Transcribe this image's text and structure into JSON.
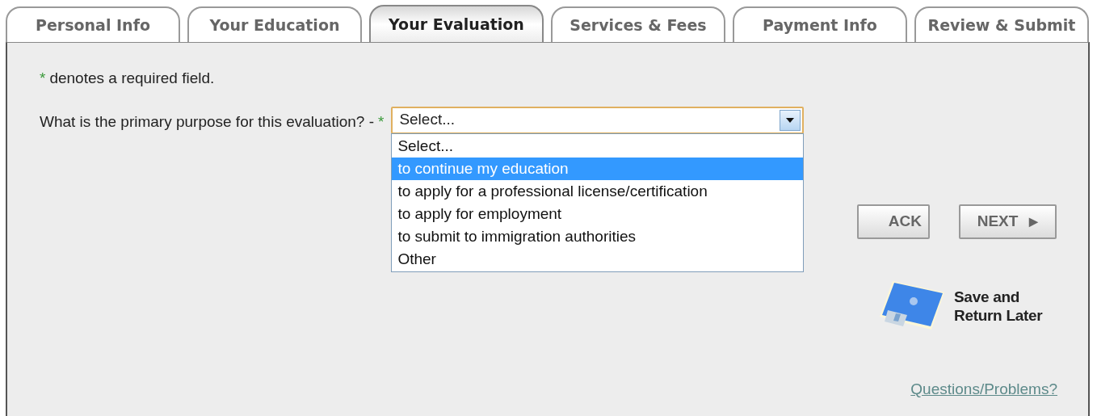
{
  "tabs": [
    {
      "label": "Personal Info",
      "selected": false
    },
    {
      "label": "Your Education",
      "selected": false
    },
    {
      "label": "Your Evaluation",
      "selected": true
    },
    {
      "label": "Services & Fees",
      "selected": false
    },
    {
      "label": "Payment Info",
      "selected": false
    },
    {
      "label": "Review & Submit",
      "selected": false
    }
  ],
  "required_note": {
    "mark": "*",
    "text": "denotes a required field."
  },
  "question": {
    "label": "What is the primary purpose for this evaluation? -",
    "required_mark": "*"
  },
  "select": {
    "value": "Select...",
    "expanded": true,
    "options": [
      {
        "label": "Select...",
        "highlighted": false
      },
      {
        "label": "to continue my education",
        "highlighted": true
      },
      {
        "label": "to apply for a professional license/certification",
        "highlighted": false
      },
      {
        "label": "to apply for employment",
        "highlighted": false
      },
      {
        "label": "to submit to immigration authorities",
        "highlighted": false
      },
      {
        "label": "Other",
        "highlighted": false
      }
    ]
  },
  "buttons": {
    "back": "ACK",
    "next": "NEXT",
    "next_arrow": "▶"
  },
  "save_later": "Save and Return Later",
  "help_link": "Questions/Problems?"
}
